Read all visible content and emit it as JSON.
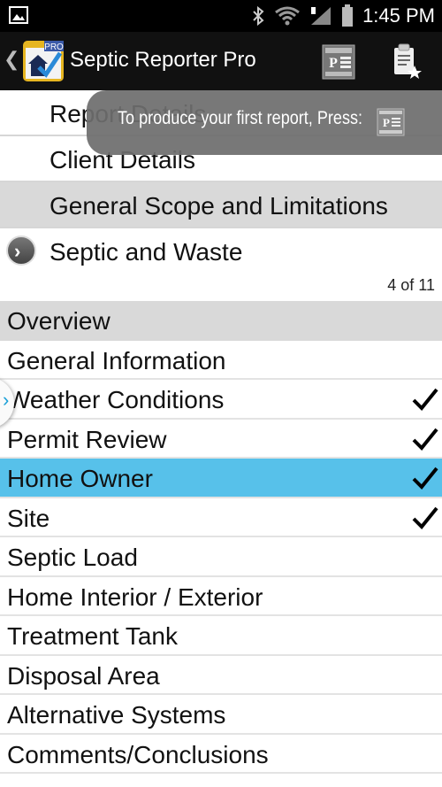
{
  "status_bar": {
    "time": "1:45 PM"
  },
  "app": {
    "title": "Septic Reporter Pro",
    "icon_badge": "PRO"
  },
  "tabs": [
    {
      "label": "Report Details"
    },
    {
      "label": "Client Details"
    },
    {
      "label": "General Scope and Limitations"
    },
    {
      "label": "Septic and Waste"
    }
  ],
  "page_indicator": "4 of 11",
  "toast": {
    "message": "To produce your first report, Press:"
  },
  "list": {
    "header": "Overview",
    "items": [
      {
        "label": "General Information",
        "checked": false
      },
      {
        "label": "Weather Conditions",
        "checked": true
      },
      {
        "label": "Permit Review",
        "checked": true
      },
      {
        "label": "Home Owner",
        "checked": true,
        "selected": true
      },
      {
        "label": "Site",
        "checked": true
      },
      {
        "label": "Septic Load",
        "checked": false
      },
      {
        "label": "Home Interior / Exterior",
        "checked": false
      },
      {
        "label": "Treatment Tank",
        "checked": false
      },
      {
        "label": "Disposal Area",
        "checked": false
      },
      {
        "label": "Alternative Systems",
        "checked": false
      },
      {
        "label": "Comments/Conclusions",
        "checked": false
      }
    ]
  },
  "colors": {
    "selected_row": "#57c1ea",
    "header_bg": "#d9d9d9",
    "action_bar": "#111111"
  }
}
